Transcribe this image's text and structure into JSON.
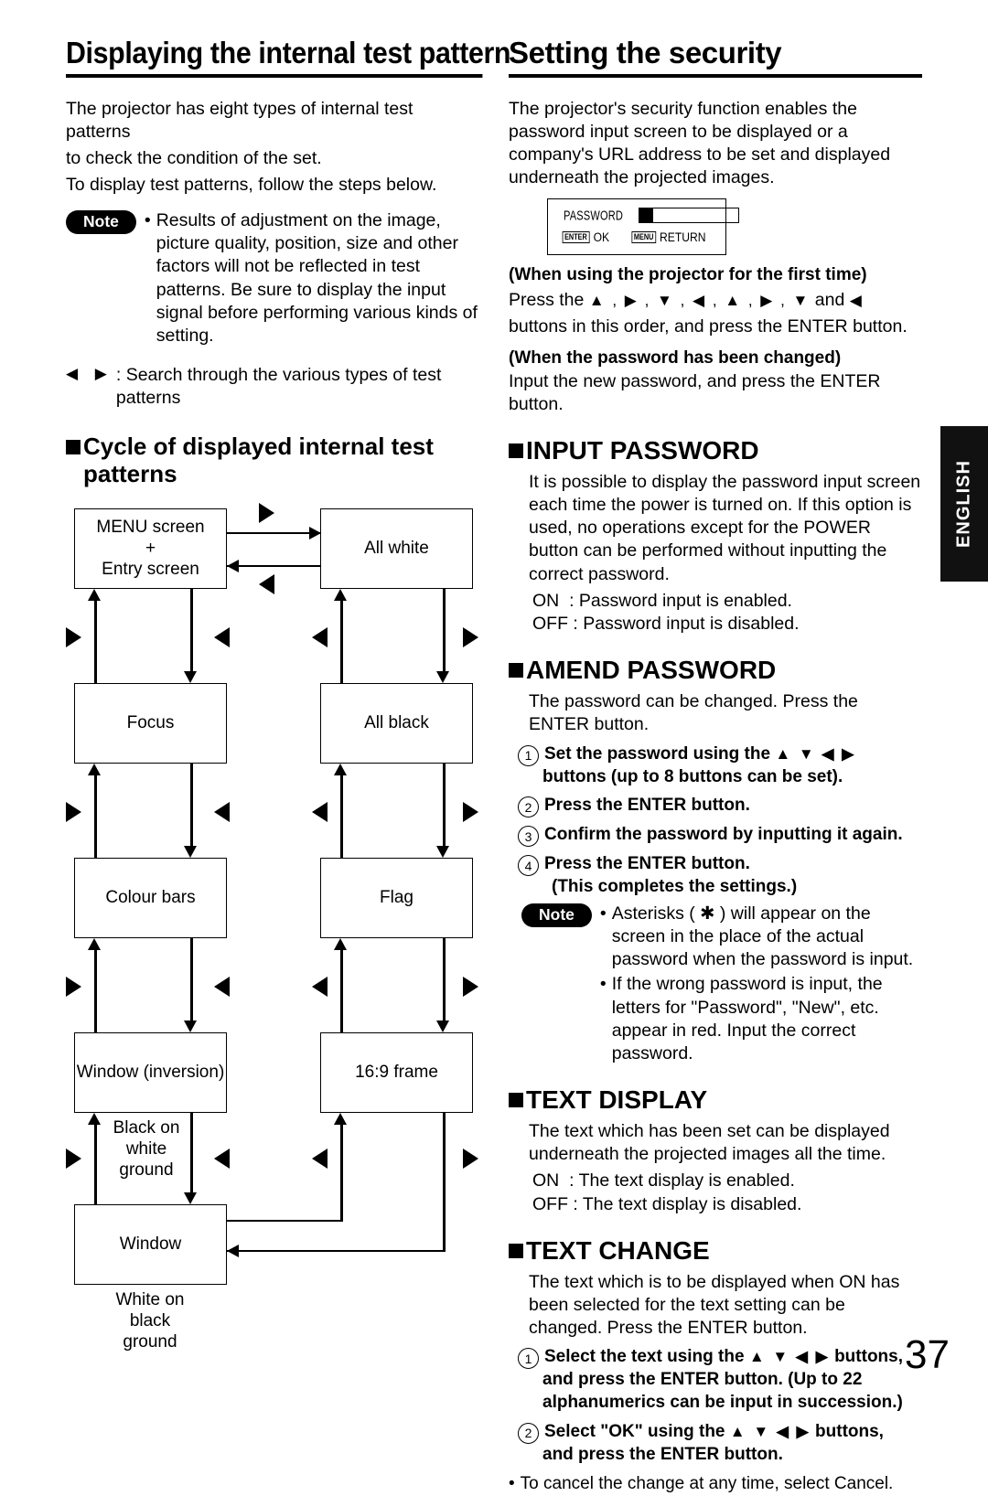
{
  "page_number": "37",
  "language_tab": "ENGLISH",
  "left_column": {
    "title": "Displaying the internal test pattern",
    "intro_lines": [
      "The projector has eight types of internal test patterns",
      "to check the condition of the set.",
      "To display test patterns, follow the steps below."
    ],
    "note": {
      "badge": "Note",
      "bullet": "•",
      "text": "Results of adjustment on the image, picture quality, position, size and other factors will not be reflected in test patterns. Be sure to display the input signal before performing various kinds of setting."
    },
    "key_legend": {
      "keys": "◀ ▶",
      "text": ": Search through the various types of test patterns"
    },
    "subhead": "Cycle of displayed internal test patterns",
    "diagram": {
      "boxes": [
        {
          "id": "menu",
          "label": "MENU screen\n+\nEntry screen"
        },
        {
          "id": "white",
          "label": "All white"
        },
        {
          "id": "focus",
          "label": "Focus"
        },
        {
          "id": "black",
          "label": "All black"
        },
        {
          "id": "colour",
          "label": "Colour bars"
        },
        {
          "id": "flag",
          "label": "Flag"
        },
        {
          "id": "wininv",
          "label": "Window (inversion)"
        },
        {
          "id": "frame169",
          "label": "16:9 frame"
        },
        {
          "id": "window",
          "label": "Window"
        }
      ],
      "annotations": [
        {
          "id": "black-on-white",
          "label": "Black on\nwhite ground"
        },
        {
          "id": "white-on-black",
          "label": "White on\nblack ground"
        }
      ]
    }
  },
  "right_column": {
    "title": "Setting the security",
    "intro": "The projector's security function enables the password input screen to be displayed or a company's URL address to be set and displayed underneath the projected images.",
    "osd": {
      "password_label": "PASSWORD",
      "enter_key": "ENTER",
      "enter_action": "OK",
      "menu_key": "MENU",
      "menu_action": "RETURN"
    },
    "first_time": {
      "heading": "(When using the projector for the first time)",
      "line_prefix": "Press the",
      "sequence": "▲ , ▶ , ▼ , ◀ , ▲ , ▶ , ▼",
      "sequence_join": "and",
      "sequence_last": "◀",
      "line_suffix": "buttons in this order, and press the ENTER button."
    },
    "changed": {
      "heading": "(When the password has been changed)",
      "body": "Input the new password, and press the ENTER button."
    },
    "sections": [
      {
        "id": "input-password",
        "heading": "INPUT PASSWORD",
        "body": "It is possible to display the password input screen each time the power is turned on. If this option is used, no operations except for the POWER button can be performed without inputting the correct password.",
        "on_label": "ON  : Password input is enabled.",
        "off_label": "OFF : Password input is disabled."
      },
      {
        "id": "amend-password",
        "heading": "AMEND PASSWORD",
        "body": "The password can be changed. Press the ENTER button.",
        "steps": [
          {
            "num": "1",
            "text_before": "Set the password using the",
            "keys": "▲ ▼ ◀ ▶",
            "text_after": "",
            "cont": "buttons (up to 8 buttons can be set)."
          },
          {
            "num": "2",
            "text_before": "Press the ENTER button.",
            "keys": "",
            "text_after": "",
            "cont": ""
          },
          {
            "num": "3",
            "text_before": "Confirm the password by inputting it again.",
            "keys": "",
            "text_after": "",
            "cont": ""
          },
          {
            "num": "4",
            "text_before": "Press the ENTER button.",
            "keys": "",
            "text_after": "",
            "cont": "(This completes the settings.)"
          }
        ],
        "note": {
          "badge": "Note",
          "bullets": [
            "Asterisks ( ✱ ) will appear on the screen in the place of the actual password when the password is input.",
            "If the wrong password is input, the letters for \"Password\", \"New\", etc. appear in red. Input the correct password."
          ]
        }
      },
      {
        "id": "text-display",
        "heading": "TEXT DISPLAY",
        "body": "The text which has been set can be displayed underneath the projected images all the time.",
        "on_label": "ON  : The text display is enabled.",
        "off_label": "OFF : The text display is disabled."
      },
      {
        "id": "text-change",
        "heading": "TEXT CHANGE",
        "body": "The text which is to be displayed when ON has been selected for the text setting can be changed. Press the ENTER button.",
        "steps": [
          {
            "num": "1",
            "text_before": "Select the text using the",
            "keys": "▲ ▼ ◀ ▶",
            "text_after": "buttons,",
            "cont": "and press the ENTER button. (Up to 22 alphanumerics can be input in succession.)"
          },
          {
            "num": "2",
            "text_before": "Select \"OK\" using the",
            "keys": "▲ ▼ ◀ ▶",
            "text_after": "buttons,",
            "cont": "and press the ENTER button."
          }
        ],
        "footnote_bullet": "•",
        "footnote": "To cancel the change at any time, select Cancel."
      }
    ]
  }
}
